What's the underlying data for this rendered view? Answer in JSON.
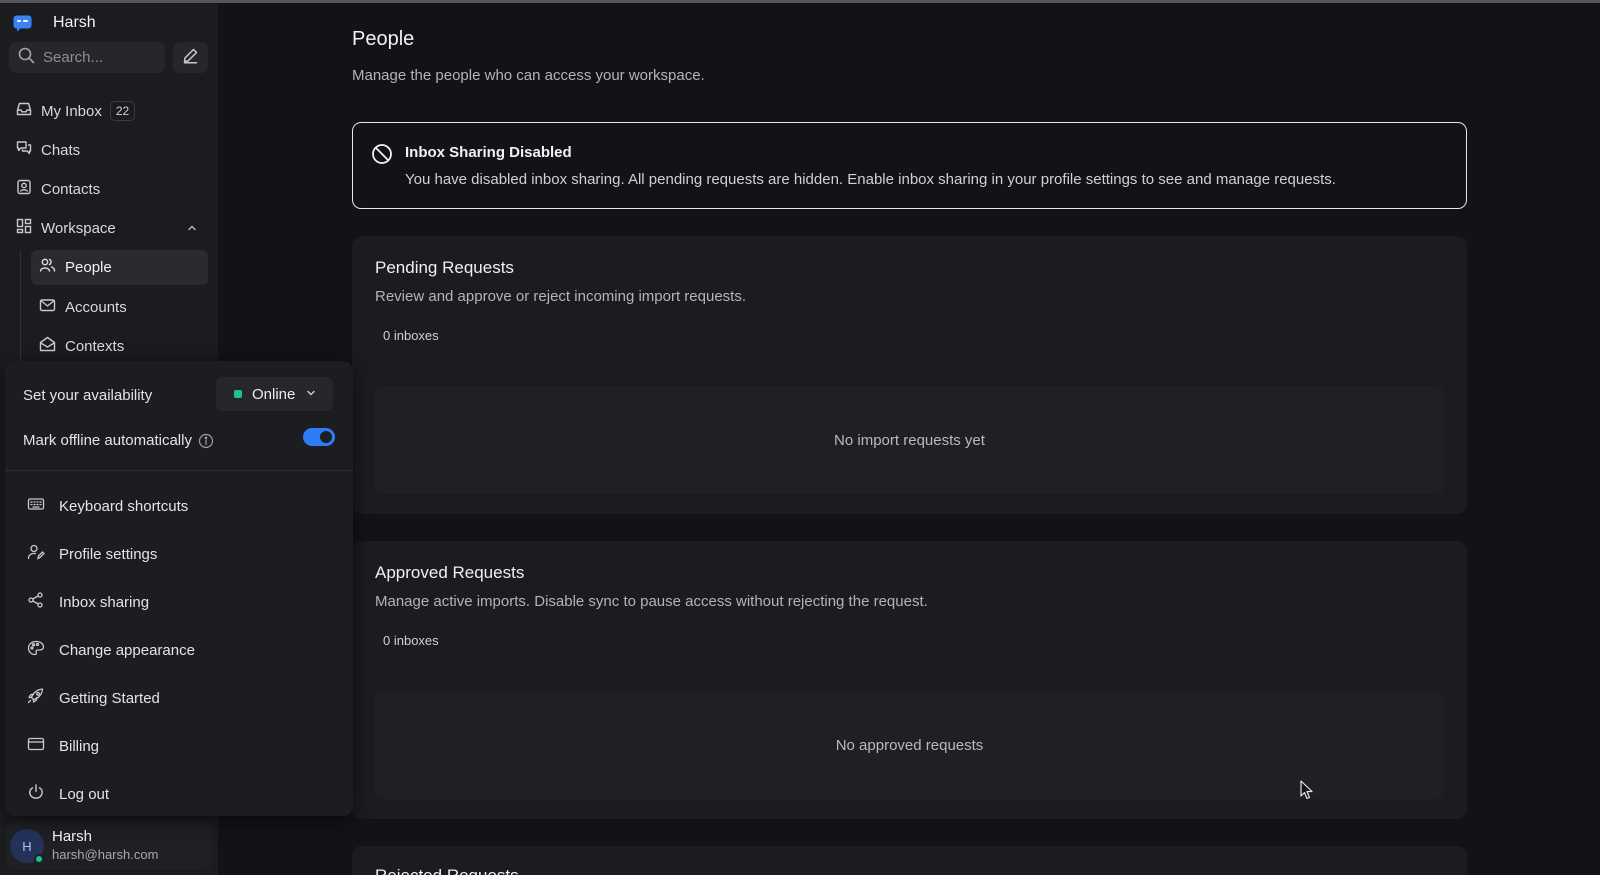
{
  "app": {
    "workspace_name": "Harsh"
  },
  "search": {
    "placeholder": "Search..."
  },
  "sidebar": {
    "items": [
      {
        "label": "My Inbox",
        "badge": "22",
        "icon": "inbox-icon"
      },
      {
        "label": "Chats",
        "icon": "chats-icon"
      },
      {
        "label": "Contacts",
        "icon": "contacts-icon"
      },
      {
        "label": "Workspace",
        "icon": "workspace-icon",
        "expanded": true
      }
    ],
    "workspace_items": [
      {
        "label": "People",
        "icon": "people-icon",
        "active": true
      },
      {
        "label": "Accounts",
        "icon": "mail-icon"
      },
      {
        "label": "Contexts",
        "icon": "open-mail-icon"
      }
    ]
  },
  "popup": {
    "availability_label": "Set your availability",
    "availability_value": "Online",
    "availability_color": "#22c08c",
    "auto_offline_label": "Mark offline automatically",
    "auto_offline_enabled": true,
    "menu": [
      {
        "label": "Keyboard shortcuts",
        "icon": "keyboard-icon"
      },
      {
        "label": "Profile settings",
        "icon": "profile-settings-icon"
      },
      {
        "label": "Inbox sharing",
        "icon": "share-icon"
      },
      {
        "label": "Change appearance",
        "icon": "palette-icon"
      },
      {
        "label": "Getting Started",
        "icon": "rocket-icon"
      },
      {
        "label": "Billing",
        "icon": "credit-card-icon"
      },
      {
        "label": "Log out",
        "icon": "power-icon"
      }
    ]
  },
  "user": {
    "initial": "H",
    "name": "Harsh",
    "email": "harsh@harsh.com"
  },
  "main": {
    "title": "People",
    "subtitle": "Manage the people who can access your workspace.",
    "alert": {
      "title": "Inbox Sharing Disabled",
      "text": "You have disabled inbox sharing. All pending requests are hidden. Enable inbox sharing in your profile settings to see and manage requests."
    },
    "pending": {
      "title": "Pending Requests",
      "subtitle": "Review and approve or reject incoming import requests.",
      "count": "0 inboxes",
      "empty": "No import requests yet"
    },
    "approved": {
      "title": "Approved Requests",
      "subtitle": "Manage active imports. Disable sync to pause access without rejecting the request.",
      "count": "0 inboxes",
      "empty": "No approved requests"
    },
    "rejected": {
      "title": "Rejected Requests"
    }
  },
  "colors": {
    "accent": "#2e7cf6",
    "online": "#22c08c",
    "brand": "#3b82f6"
  }
}
